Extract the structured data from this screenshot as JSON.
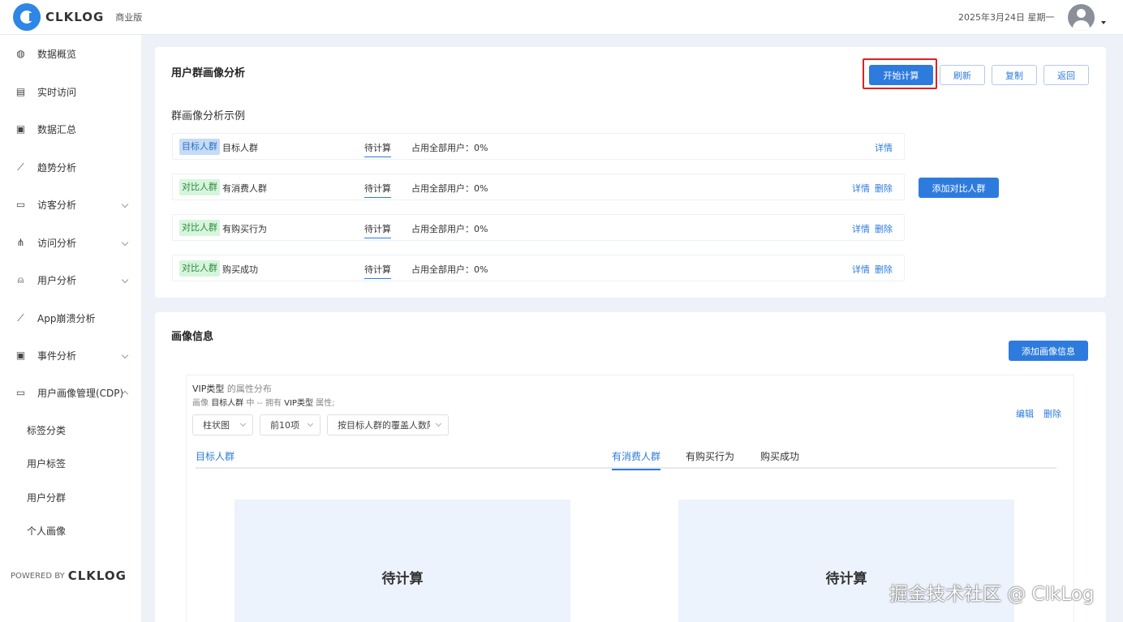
{
  "header": {
    "logo_text": "CLKLOG",
    "edition": "商业版",
    "date": "2025年3月24日 星期一"
  },
  "sidebar": {
    "items": [
      {
        "label": "数据概览",
        "icon": "dashboard-icon"
      },
      {
        "label": "实时访问",
        "icon": "realtime-icon"
      },
      {
        "label": "数据汇总",
        "icon": "summary-icon"
      },
      {
        "label": "趋势分析",
        "icon": "trend-icon"
      },
      {
        "label": "访客分析",
        "icon": "visitor-icon"
      },
      {
        "label": "访问分析",
        "icon": "access-icon"
      },
      {
        "label": "用户分析",
        "icon": "user-icon"
      },
      {
        "label": "App崩溃分析",
        "icon": "crash-icon"
      },
      {
        "label": "事件分析",
        "icon": "event-icon"
      },
      {
        "label": "用户画像管理(CDP)",
        "icon": "cdp-icon"
      }
    ],
    "sub_items": [
      "标签分类",
      "用户标签",
      "用户分群",
      "个人画像"
    ],
    "powered_by": "POWERED BY",
    "powered_logo": "CLKLOG"
  },
  "card1": {
    "title": "用户群画像分析",
    "buttons": {
      "start": "开始计算",
      "refresh": "刷新",
      "copy": "复制",
      "back": "返回"
    },
    "subtitle": "群画像分析示例",
    "add_compare": "添加对比人群",
    "rows": [
      {
        "tag": "目标人群",
        "name": "目标人群",
        "status": "待计算",
        "ratio": "占用全部用户：0%",
        "detail": "详情"
      },
      {
        "tag": "对比人群",
        "name": "有消费人群",
        "status": "待计算",
        "ratio": "占用全部用户：0%",
        "detail": "详情",
        "delete": "删除"
      },
      {
        "tag": "对比人群",
        "name": "有购买行为",
        "status": "待计算",
        "ratio": "占用全部用户：0%",
        "detail": "详情",
        "delete": "删除"
      },
      {
        "tag": "对比人群",
        "name": "购买成功",
        "status": "待计算",
        "ratio": "占用全部用户：0%",
        "detail": "详情",
        "delete": "删除"
      }
    ]
  },
  "card2": {
    "title": "画像信息",
    "add_profile": "添加画像信息",
    "attr_name": "VIP类型",
    "attr_suffix": "的属性分布",
    "desc_prefix": "画像",
    "desc_group": "目标人群",
    "desc_mid": "中 -- 拥有",
    "desc_attr": "VIP类型",
    "desc_suffix": "属性;",
    "edit": "编辑",
    "delete": "删除",
    "selects": {
      "chart_type": "柱状图",
      "top_n": "前10项",
      "sort": "按目标人群的覆盖人数降序"
    },
    "left_tab": "目标人群",
    "right_tabs": [
      "有消费人群",
      "有购买行为",
      "购买成功"
    ],
    "pending_left": "待计算",
    "pending_right": "待计算"
  },
  "watermark": "掘金技术社区 @ ClkLog"
}
